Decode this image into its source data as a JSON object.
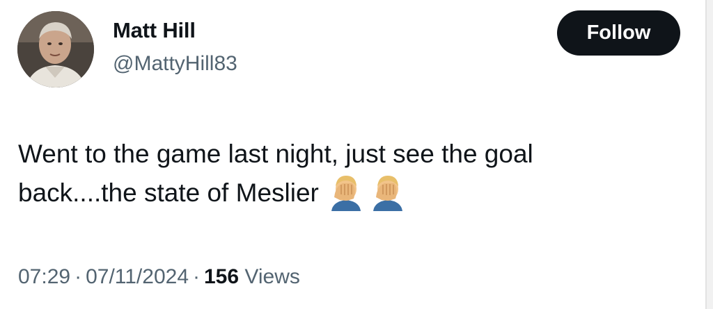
{
  "user": {
    "display_name": "Matt Hill",
    "handle": "@MattyHill83"
  },
  "follow_button": {
    "label": "Follow"
  },
  "tweet": {
    "line1": "Went to the game last night, just see the goal",
    "line2": "back....the state of Meslier",
    "emojis": [
      "facepalm-emoji",
      "facepalm-emoji"
    ]
  },
  "meta": {
    "time": "07:29",
    "separator": "·",
    "date": "07/11/2024",
    "views_count": "156",
    "views_label": "Views"
  },
  "colors": {
    "text_primary": "#0f1419",
    "text_secondary": "#536471",
    "button_bg": "#0f1419",
    "button_text": "#ffffff"
  }
}
